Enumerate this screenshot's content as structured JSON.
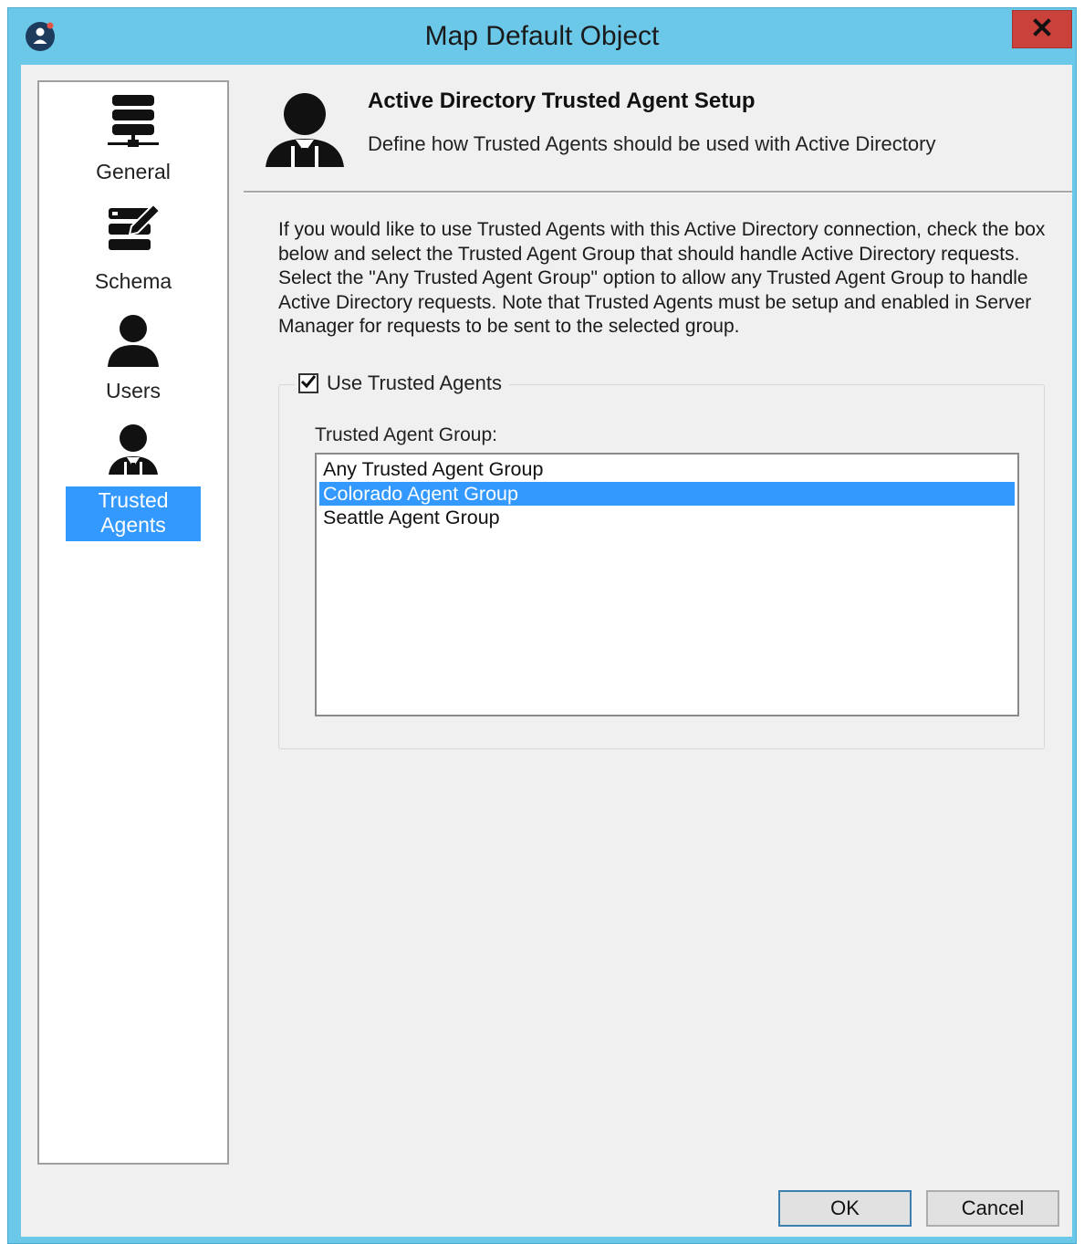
{
  "window": {
    "title": "Map Default Object",
    "close_label": "x"
  },
  "nav": {
    "items": [
      {
        "label": "General",
        "icon": "server-icon",
        "selected": false
      },
      {
        "label": "Schema",
        "icon": "schema-edit-icon",
        "selected": false
      },
      {
        "label": "Users",
        "icon": "user-icon",
        "selected": false
      },
      {
        "label": "Trusted Agents",
        "icon": "agent-icon",
        "selected": true
      }
    ]
  },
  "header": {
    "title": "Active Directory Trusted Agent Setup",
    "subtitle": "Define how Trusted Agents should be used with Active Directory",
    "icon": "agent-icon"
  },
  "description": "If you would like to use Trusted Agents with this Active Directory connection, check the box below and select the Trusted Agent Group that should handle Active Directory requests. Select the \"Any Trusted Agent Group\" option to allow any Trusted Agent Group to handle Active Directory requests. Note that Trusted Agents must be setup and enabled in Server Manager for requests to be sent to the selected group.",
  "group": {
    "checkbox_label": "Use Trusted Agents",
    "checked": true,
    "field_label": "Trusted Agent Group:",
    "options": [
      {
        "label": "Any Trusted Agent Group",
        "selected": false
      },
      {
        "label": "Colorado Agent Group",
        "selected": true
      },
      {
        "label": "Seattle Agent Group",
        "selected": false
      }
    ]
  },
  "buttons": {
    "ok": "OK",
    "cancel": "Cancel"
  },
  "colors": {
    "titlebar": "#6cc8e8",
    "close": "#c9413a",
    "selection": "#3399ff"
  }
}
